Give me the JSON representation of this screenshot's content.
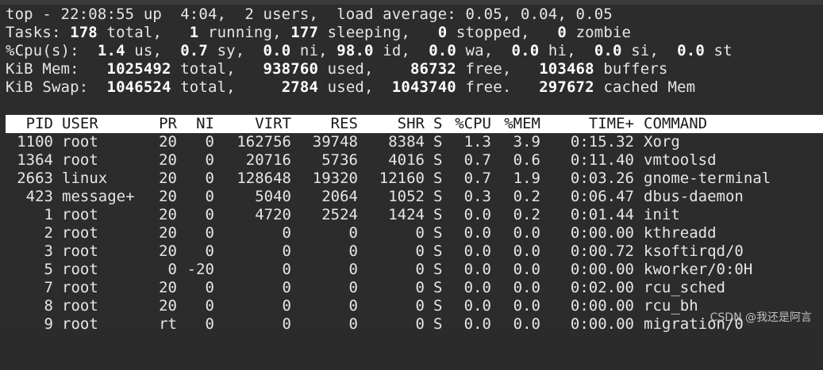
{
  "summary": {
    "line1": "top - 22:08:55 up  4:04,  2 users,  load average: 0.05, 0.04, 0.05",
    "tasks": [
      "Tasks: ",
      "178",
      " total,   ",
      "1",
      " running, ",
      "177",
      " sleeping,   ",
      "0",
      " stopped,   ",
      "0",
      " zombie"
    ],
    "cpu": [
      "%Cpu(s):  ",
      "1.4",
      " us,  ",
      "0.7",
      " sy,  ",
      "0.0",
      " ni, ",
      "98.0",
      " id,  ",
      "0.0",
      " wa,  ",
      "0.0",
      " hi,  ",
      "0.0",
      " si,  ",
      "0.0",
      " st"
    ],
    "mem": [
      "KiB Mem:   ",
      "1025492",
      " total,   ",
      "938760",
      " used,    ",
      "86732",
      " free,   ",
      "103468",
      " buffers"
    ],
    "swap": [
      "KiB Swap:  ",
      "1046524",
      " total,     ",
      "2784",
      " used,  ",
      "1043740",
      " free.   ",
      "297672",
      " cached Mem"
    ]
  },
  "columns": [
    "PID",
    "USER",
    "PR",
    "NI",
    "VIRT",
    "RES",
    "SHR",
    "S",
    "%CPU",
    "%MEM",
    "TIME+",
    "COMMAND"
  ],
  "processes": [
    [
      "1100",
      "root",
      "20",
      "0",
      "162756",
      "39748",
      "8384",
      "S",
      "1.3",
      "3.9",
      "0:15.32",
      "Xorg"
    ],
    [
      "1364",
      "root",
      "20",
      "0",
      "20716",
      "5736",
      "4016",
      "S",
      "0.7",
      "0.6",
      "0:11.40",
      "vmtoolsd"
    ],
    [
      "2663",
      "linux",
      "20",
      "0",
      "128648",
      "19320",
      "12160",
      "S",
      "0.7",
      "1.9",
      "0:03.26",
      "gnome-terminal"
    ],
    [
      "423",
      "message+",
      "20",
      "0",
      "5040",
      "2064",
      "1052",
      "S",
      "0.3",
      "0.2",
      "0:06.47",
      "dbus-daemon"
    ],
    [
      "1",
      "root",
      "20",
      "0",
      "4720",
      "2524",
      "1424",
      "S",
      "0.0",
      "0.2",
      "0:01.44",
      "init"
    ],
    [
      "2",
      "root",
      "20",
      "0",
      "0",
      "0",
      "0",
      "S",
      "0.0",
      "0.0",
      "0:00.00",
      "kthreadd"
    ],
    [
      "3",
      "root",
      "20",
      "0",
      "0",
      "0",
      "0",
      "S",
      "0.0",
      "0.0",
      "0:00.72",
      "ksoftirqd/0"
    ],
    [
      "5",
      "root",
      "0",
      "-20",
      "0",
      "0",
      "0",
      "S",
      "0.0",
      "0.0",
      "0:00.00",
      "kworker/0:0H"
    ],
    [
      "7",
      "root",
      "20",
      "0",
      "0",
      "0",
      "0",
      "S",
      "0.0",
      "0.0",
      "0:02.00",
      "rcu_sched"
    ],
    [
      "8",
      "root",
      "20",
      "0",
      "0",
      "0",
      "0",
      "S",
      "0.0",
      "0.0",
      "0:00.00",
      "rcu_bh"
    ],
    [
      "9",
      "root",
      "rt",
      "0",
      "0",
      "0",
      "0",
      "S",
      "0.0",
      "0.0",
      "0:00.00",
      "migration/0"
    ]
  ],
  "watermark": "CSDN @我还是阿言",
  "colors": {
    "background": "#2c2c2c",
    "text": "#e6e6e6",
    "header_bg": "#ffffff",
    "header_text": "#1a1a1a"
  }
}
